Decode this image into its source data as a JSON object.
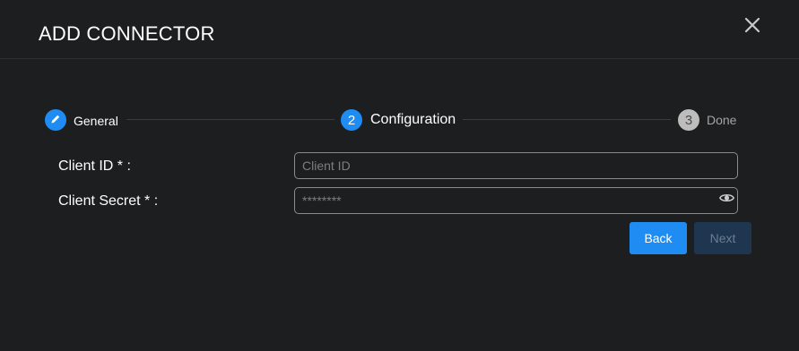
{
  "dialog": {
    "title": "ADD CONNECTOR",
    "close_icon": "close-icon"
  },
  "stepper": {
    "steps": [
      {
        "number": "",
        "label": "General",
        "state": "completed",
        "icon": "pencil-icon"
      },
      {
        "number": "2",
        "label": "Configuration",
        "state": "current"
      },
      {
        "number": "3",
        "label": "Done",
        "state": "pending"
      }
    ]
  },
  "form": {
    "client_id": {
      "label": "Client ID * :",
      "value": "",
      "placeholder": "Client ID"
    },
    "client_secret": {
      "label": "Client Secret * :",
      "value": "",
      "placeholder": "********",
      "icon": "eye-icon"
    }
  },
  "actions": {
    "back_label": "Back",
    "next_label": "Next",
    "next_disabled": true
  },
  "colors": {
    "background": "#1d1e20",
    "accent": "#1f8cf3",
    "disabled_button": "#1f3651"
  }
}
